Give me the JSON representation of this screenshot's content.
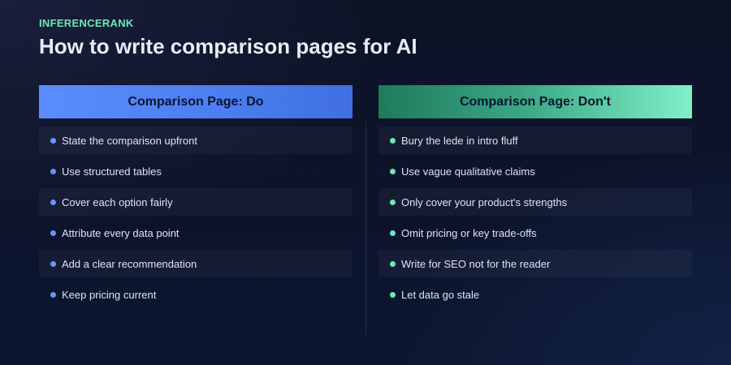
{
  "brand": "INFERENCERANK",
  "title": "How to write comparison pages for AI",
  "do_column": {
    "header": "Comparison Page: Do",
    "items": [
      "State the comparison upfront",
      "Use structured tables",
      "Cover each option fairly",
      "Attribute every data point",
      "Add a clear recommendation",
      "Keep pricing current"
    ]
  },
  "dont_column": {
    "header": "Comparison Page: Don't",
    "items": [
      "Bury the lede in intro fluff",
      "Use vague qualitative claims",
      "Only cover your product's strengths",
      "Omit pricing or key trade-offs",
      "Write for SEO not for the reader",
      "Let data go stale"
    ]
  },
  "colors": {
    "brand": "#6ee7b7",
    "do_accent": "#5b8cff",
    "dont_accent": "#3aa684",
    "background": "#0d1226"
  }
}
